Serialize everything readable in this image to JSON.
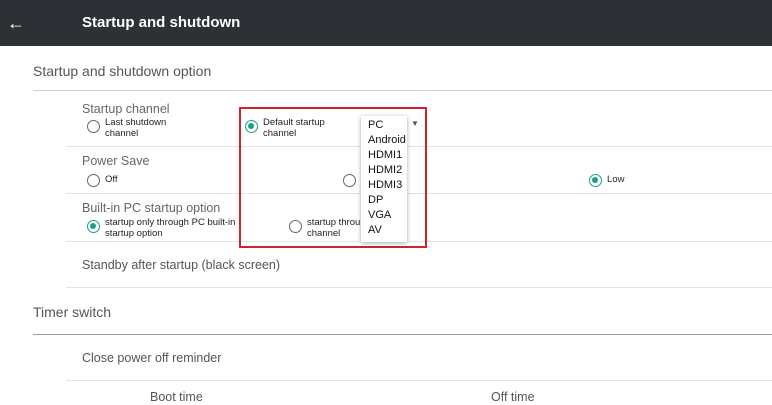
{
  "header": {
    "title": "Startup and shutdown",
    "back_icon": "arrow-left-icon"
  },
  "sections": {
    "startup_shutdown_option": "Startup and shutdown option",
    "timer_switch": "Timer switch"
  },
  "startup_channel": {
    "label": "Startup channel",
    "options": [
      {
        "label_line1": "Last shutdown",
        "label_line2": "channel",
        "selected": false
      },
      {
        "label_line1": "Default startup",
        "label_line2": "channel",
        "selected": true
      }
    ],
    "dropdown_arrow": "▼",
    "dropdown_options": [
      "PC",
      "Android",
      "HDMI1",
      "HDMI2",
      "HDMI3",
      "DP",
      "VGA",
      "AV"
    ]
  },
  "power_save": {
    "label": "Power Save",
    "options": [
      {
        "label": "Off",
        "selected": false
      },
      {
        "label": "",
        "selected": false
      },
      {
        "label": "Low",
        "selected": true
      }
    ]
  },
  "builtin_pc": {
    "label": "Built-in PC startup option",
    "options": [
      {
        "label_line1": "startup only through PC built-in",
        "label_line2": "startup option",
        "selected": true
      },
      {
        "label_line1": "startup throu",
        "label_line2": "channel",
        "selected": false
      }
    ]
  },
  "standby": {
    "label": "Standby after startup (black screen)"
  },
  "close_power_off_reminder": {
    "label": "Close power off reminder"
  },
  "timer_columns": {
    "boot_time": "Boot time",
    "off_time": "Off time"
  },
  "colors": {
    "accent": "#1aa085",
    "header_bg": "#2d3135",
    "highlight": "#d0242b"
  }
}
